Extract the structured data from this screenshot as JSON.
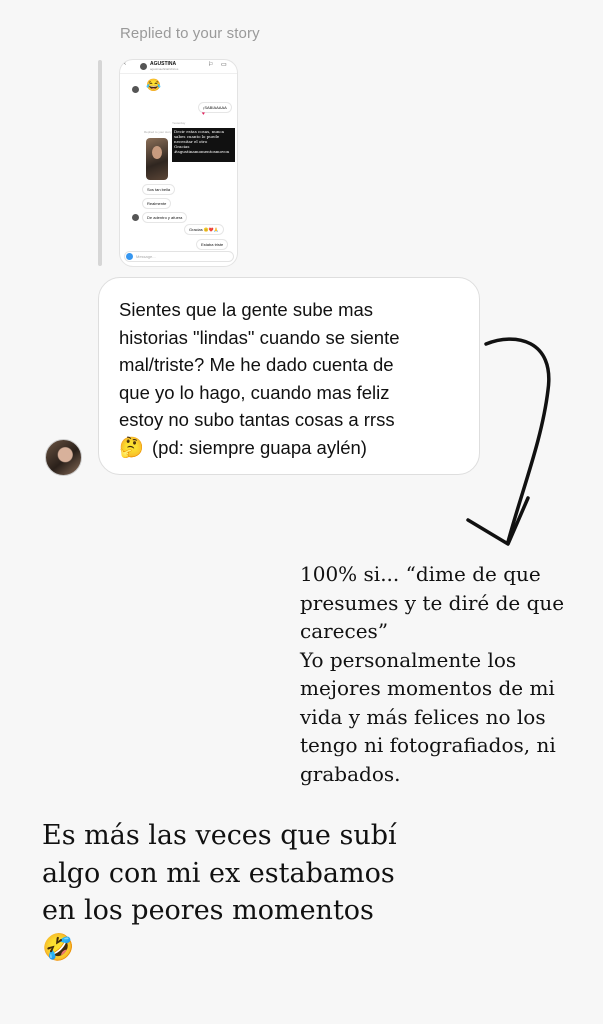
{
  "story_reply": {
    "label": "Replied to your story"
  },
  "story_thumbnail": {
    "account_name": "AGUSTINA",
    "account_sub": "agustinaoficial/chicos",
    "emoji_top": "😂",
    "bubble_right_1": "¡SABIAAAAA",
    "heart": "♥",
    "dark_box_text": "Decir estas cosas, nunca\nsabes cuanto lo puede\nnecesitar el otro\nGracias\n#agustinamomentosmovon",
    "label_replied": "Replied to your story",
    "label_time": "Yesterday",
    "bubble_left_1": "Sos tan bella",
    "bubble_left_2": "Realmente",
    "bubble_left_3": "De adentro y afuera",
    "bubble_right_2": "Gracias 🙂❤️🙏",
    "bubble_right_3": "Estaba triste",
    "input_placeholder": "Message..."
  },
  "message": {
    "lines": [
      "Sientes que la gente sube mas",
      "historias \"lindas\" cuando se siente",
      "mal/triste? Me he dado cuenta de",
      "que yo lo hago, cuando mas feliz",
      "estoy no subo tantas cosas a rrss"
    ],
    "emoji": "🤔",
    "last_line": "(pd: siempre guapa aylén)"
  },
  "reply": {
    "lines": [
      "100% si... “dime de que",
      "presumes y te diré de que",
      "careces”",
      "Yo personalmente los",
      "mejores momentos de mi",
      "vida y más felices no los",
      "tengo ni fotografiados, ni",
      "grabados."
    ]
  },
  "bottom": {
    "lines": [
      "Es más las veces que subí",
      "algo con mi ex estabamos",
      "en los peores momentos"
    ],
    "emoji": "🤣"
  },
  "colors": {
    "background": "#f7f7f7",
    "bubble_border": "#dedede",
    "label_gray": "#9a9a9a"
  }
}
